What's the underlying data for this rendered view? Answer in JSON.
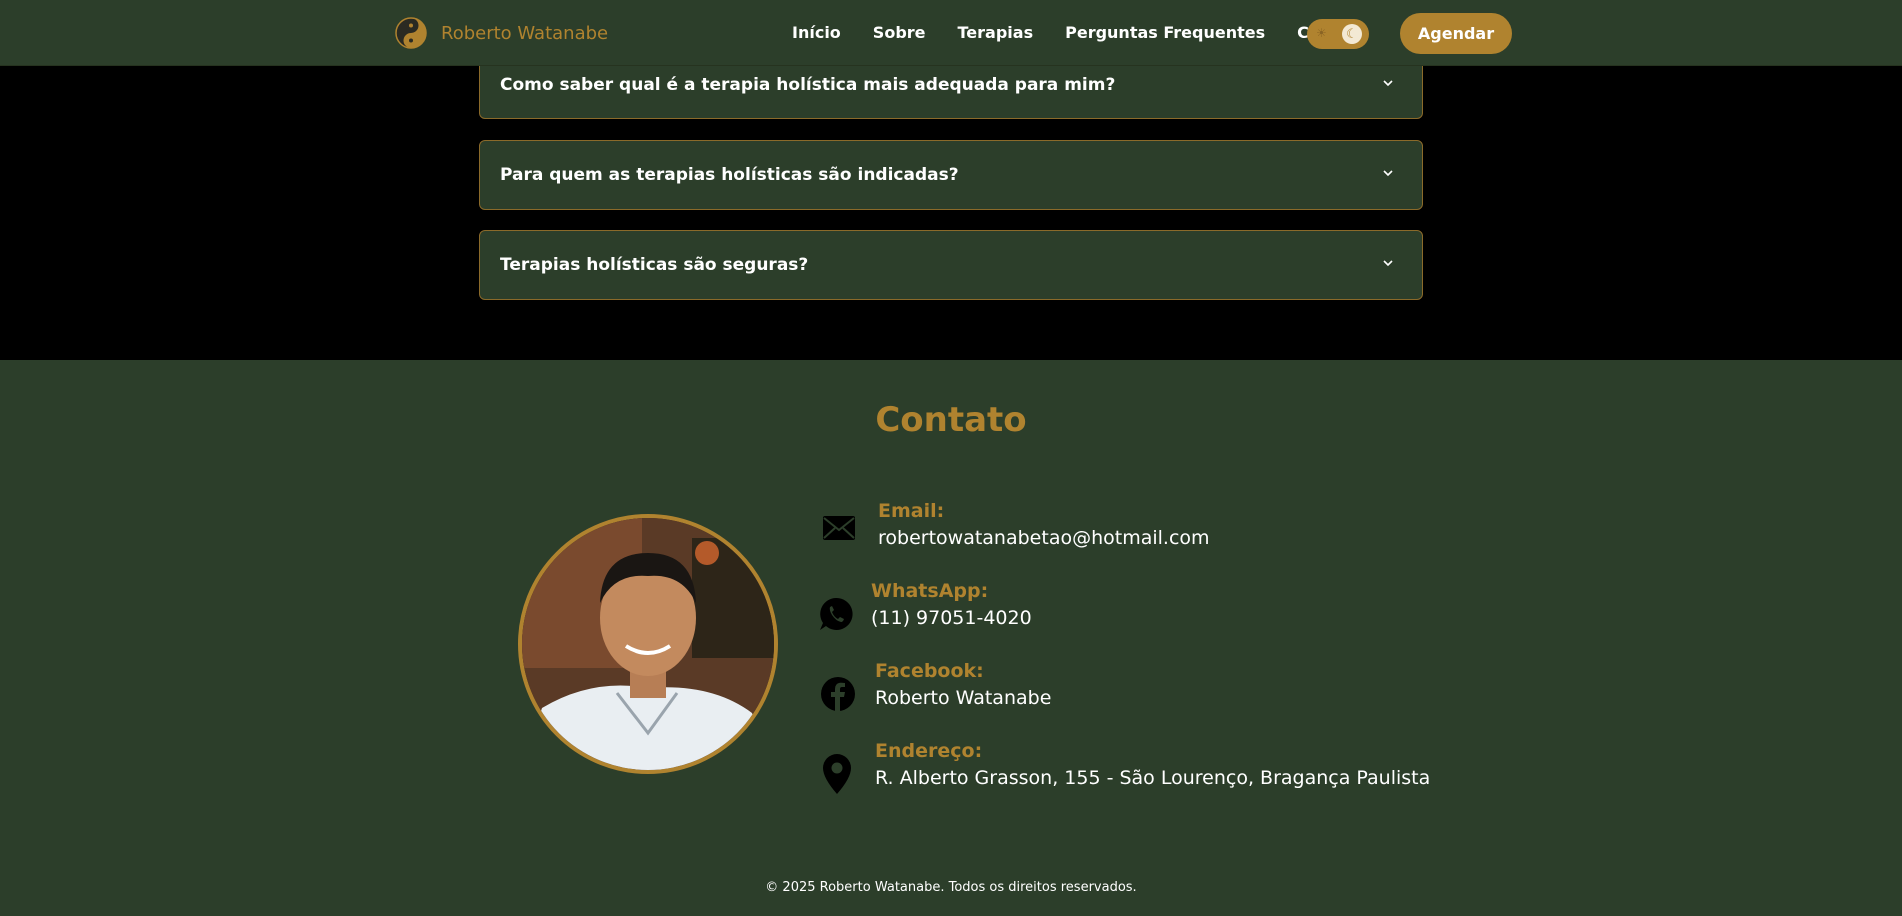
{
  "header": {
    "brand": "Roberto Watanabe",
    "nav": [
      "Início",
      "Sobre",
      "Terapias",
      "Perguntas Frequentes",
      "Contato"
    ],
    "cta": "Agendar",
    "theme_toggle_icons": [
      "sun-icon",
      "moon-icon"
    ]
  },
  "faq": {
    "items": [
      "Como saber qual é a terapia holística mais adequada para mim?",
      "Para quem as terapias holísticas são indicadas?",
      "Terapias holísticas são seguras?"
    ]
  },
  "contact": {
    "title": "Contato",
    "email": {
      "label": "Email:",
      "value": "robertowatanabetao@hotmail.com",
      "icon": "envelope-icon"
    },
    "whatsapp": {
      "label": "WhatsApp:",
      "value": "(11) 97051-4020",
      "icon": "whatsapp-icon"
    },
    "facebook": {
      "label": "Facebook:",
      "value": "Roberto Watanabe",
      "icon": "facebook-icon"
    },
    "address": {
      "label": "Endereço:",
      "value": "R. Alberto Grasson, 155 - São Lourenço, Bragança Paulista",
      "icon": "map-pin-icon"
    }
  },
  "footer": {
    "text": "© 2025 Roberto Watanabe. Todos os direitos reservados."
  },
  "colors": {
    "accent": "#b0832f",
    "panel": "#2c3e2a",
    "background": "#000000"
  }
}
